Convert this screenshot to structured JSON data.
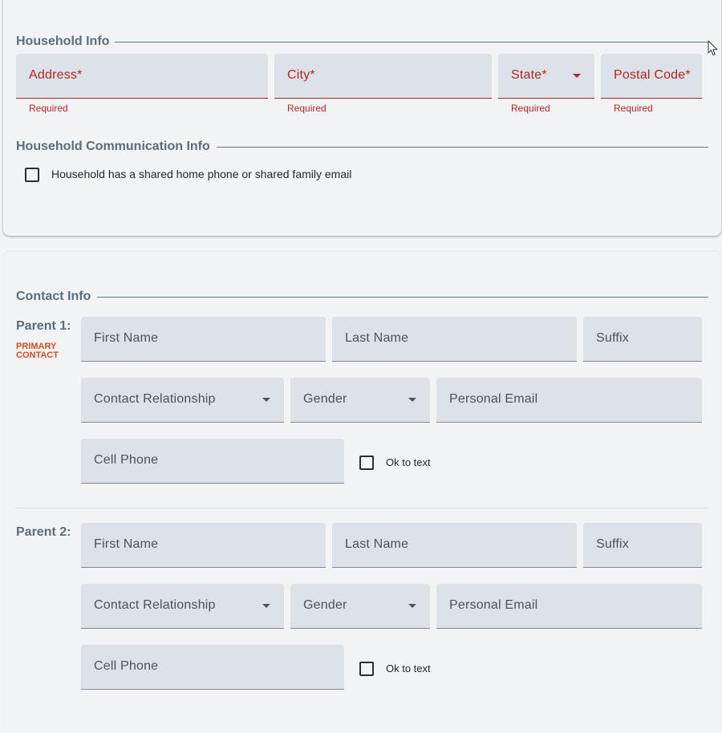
{
  "household": {
    "title": "Household Info",
    "address": {
      "label": "Address*",
      "helper": "Required"
    },
    "city": {
      "label": "City*",
      "helper": "Required"
    },
    "state": {
      "label": "State*",
      "helper": "Required"
    },
    "postal": {
      "label": "Postal Code*",
      "helper": "Required"
    }
  },
  "communication": {
    "title": "Household Communication Info",
    "shared_label": "Household has a shared home phone or shared family email"
  },
  "contact": {
    "title": "Contact Info",
    "parents": [
      {
        "label": "Parent 1:",
        "badge": "PRIMARY CONTACT",
        "first_name": "First Name",
        "last_name": "Last Name",
        "suffix": "Suffix",
        "relationship": "Contact Relationship",
        "gender": "Gender",
        "email": "Personal Email",
        "cell": "Cell Phone",
        "ok_text": "Ok to text"
      },
      {
        "label": "Parent 2:",
        "first_name": "First Name",
        "last_name": "Last Name",
        "suffix": "Suffix",
        "relationship": "Contact Relationship",
        "gender": "Gender",
        "email": "Personal Email",
        "cell": "Cell Phone",
        "ok_text": "Ok to text"
      }
    ]
  },
  "icons": {
    "cursor": "mouse-pointer-icon",
    "dropdown": "triangle-down"
  },
  "colors": {
    "error": "#b3261e",
    "primary_badge": "#d64a1f",
    "section_title": "#5a6d7c",
    "field_bg": "#dde2e8"
  }
}
